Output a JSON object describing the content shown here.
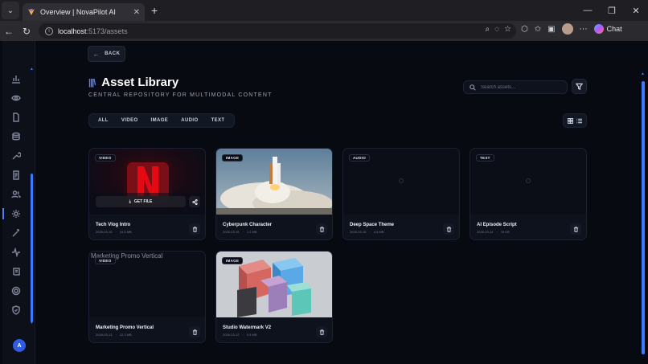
{
  "browser": {
    "tab_title": "Overview | NovaPilot AI",
    "url_host": "localhost",
    "url_path": ":5173/assets",
    "chat_label": "Chat"
  },
  "page": {
    "back_label": "BACK",
    "title": "Asset Library",
    "subtitle": "CENTRAL REPOSITORY FOR MULTIMODAL CONTENT",
    "search_placeholder": "Search assets...",
    "filter_tabs": [
      "ALL",
      "VIDEO",
      "IMAGE",
      "AUDIO",
      "TEXT"
    ],
    "get_file_label": "GET FILE"
  },
  "user": {
    "initial": "A"
  },
  "assets": [
    {
      "type": "VIDEO",
      "name": "Tech Vlog Intro",
      "date": "2026-03-15",
      "size": "24.5 MB",
      "thumb": "netflix"
    },
    {
      "type": "IMAGE",
      "name": "Cyberpunk Character",
      "date": "2026-03-15",
      "size": "1.2 MB",
      "thumb": "rocket"
    },
    {
      "type": "AUDIO",
      "name": "Deep Space Theme",
      "date": "2026-03-16",
      "size": "4.5 MB",
      "thumb": "none"
    },
    {
      "type": "TEXT",
      "name": "AI Episode Script",
      "date": "2026-03-14",
      "size": "15 KB",
      "thumb": "none"
    },
    {
      "type": "VIDEO",
      "name": "Marketing Promo Vertical",
      "date": "2026-03-13",
      "size": "12.3 MB",
      "thumb": "broken",
      "alt": "Marketing Promo Vertical"
    },
    {
      "type": "IMAGE",
      "name": "Studio Watermark V2",
      "date": "2026-03-12",
      "size": "0.5 MB",
      "thumb": "cubes"
    }
  ],
  "colors": {
    "accent": "#3a7bff",
    "bg": "#080a12",
    "card": "#0e121d"
  }
}
